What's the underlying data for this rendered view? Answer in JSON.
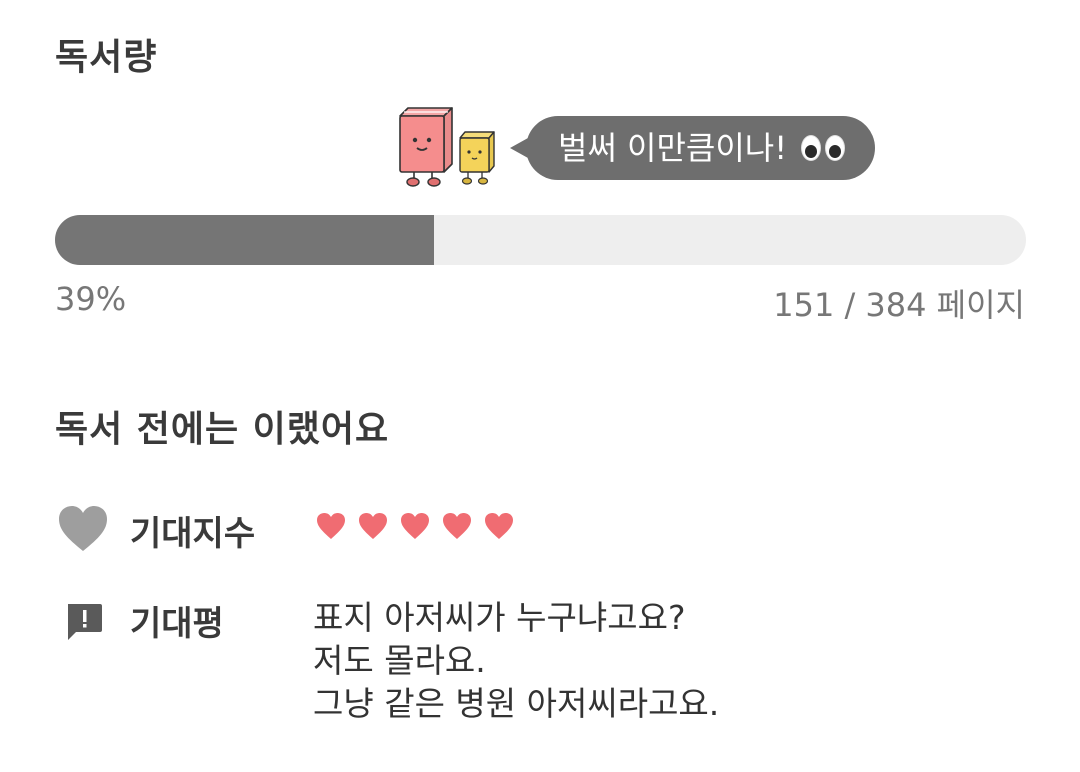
{
  "reading": {
    "title": "독서량",
    "bubble_text": "벌써 이만큼이나!",
    "bubble_emoji": "eyes-emoji",
    "progress_fraction": 0.39,
    "percent_text": "39%",
    "pages_text": "151 / 384 페이지",
    "colors": {
      "progress_fill": "#757575",
      "progress_track": "#eeeeee",
      "bubble": "#6e6e6e"
    },
    "mascots": [
      "pink-book-mascot-icon",
      "yellow-book-mascot-icon"
    ]
  },
  "before": {
    "title": "독서 전에는 이랬어요",
    "expectation": {
      "icon": "heart-icon",
      "label": "기대지수",
      "rating": 5,
      "rating_max": 5,
      "rating_color": "#f06c72"
    },
    "review": {
      "icon": "comment-alert-icon",
      "label": "기대평",
      "lines": [
        "표지 아저씨가 누구냐고요?",
        "저도 몰라요.",
        "그냥 같은 병원 아저씨라고요."
      ]
    }
  }
}
